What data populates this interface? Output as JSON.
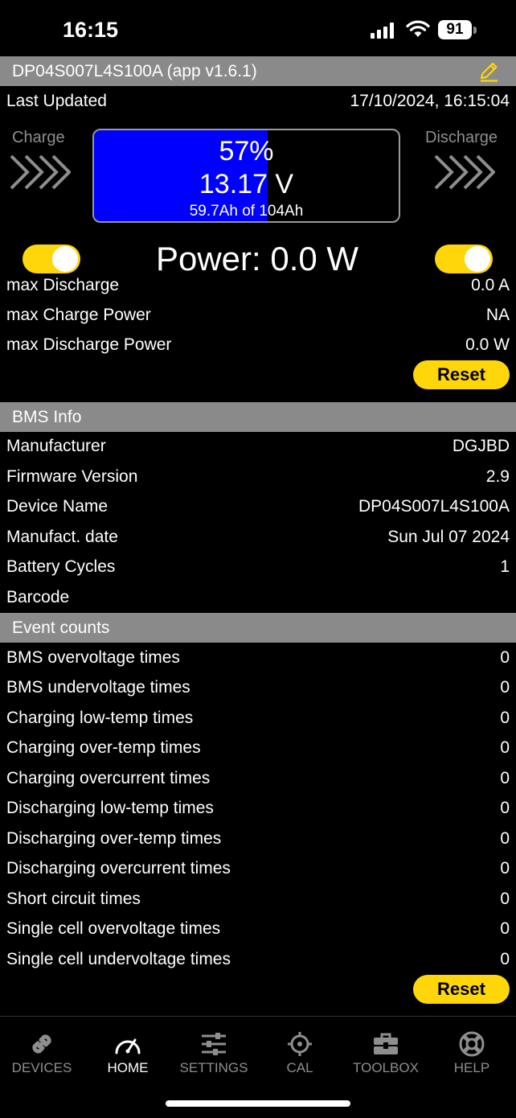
{
  "status": {
    "time": "16:15",
    "battery": "91"
  },
  "header": {
    "title": "DP04S007L4S100A (app v1.6.1)"
  },
  "last_updated": {
    "label": "Last Updated",
    "value": "17/10/2024, 16:15:04"
  },
  "gauge": {
    "charge_label": "Charge",
    "discharge_label": "Discharge",
    "percent_text": "57%",
    "percent": 57,
    "voltage": "13.17 V",
    "capacity": "59.7Ah of 104Ah",
    "power": "Power: 0.0 W",
    "charge_enabled": true,
    "discharge_enabled": true
  },
  "max_stats": [
    {
      "label": "max Discharge",
      "value": "0.0 A"
    },
    {
      "label": "max Charge Power",
      "value": "NA"
    },
    {
      "label": "max Discharge Power",
      "value": "0.0 W"
    }
  ],
  "reset_label": "Reset",
  "bms": {
    "title": "BMS Info",
    "rows": [
      {
        "label": "Manufacturer",
        "value": "DGJBD"
      },
      {
        "label": "Firmware Version",
        "value": "2.9"
      },
      {
        "label": "Device Name",
        "value": "DP04S007L4S100A"
      },
      {
        "label": "Manufact. date",
        "value": "Sun Jul 07 2024"
      },
      {
        "label": "Battery Cycles",
        "value": "1"
      },
      {
        "label": "Barcode",
        "value": ""
      }
    ]
  },
  "events": {
    "title": "Event counts",
    "rows": [
      {
        "label": "BMS overvoltage times",
        "value": "0"
      },
      {
        "label": "BMS undervoltage times",
        "value": "0"
      },
      {
        "label": "Charging low-temp times",
        "value": "0"
      },
      {
        "label": "Charging over-temp times",
        "value": "0"
      },
      {
        "label": "Charging overcurrent times",
        "value": "0"
      },
      {
        "label": "Discharging low-temp times",
        "value": "0"
      },
      {
        "label": "Discharging over-temp times",
        "value": "0"
      },
      {
        "label": "Discharging overcurrent times",
        "value": "0"
      },
      {
        "label": "Short circuit times",
        "value": "0"
      },
      {
        "label": "Single cell overvoltage times",
        "value": "0"
      },
      {
        "label": "Single cell undervoltage times",
        "value": "0"
      }
    ]
  },
  "tabs": [
    {
      "label": "DEVICES",
      "icon": "link-icon",
      "active": false
    },
    {
      "label": "HOME",
      "icon": "speedometer-icon",
      "active": true
    },
    {
      "label": "SETTINGS",
      "icon": "sliders-icon",
      "active": false
    },
    {
      "label": "CAL",
      "icon": "crosshair-icon",
      "active": false
    },
    {
      "label": "TOOLBOX",
      "icon": "toolbox-icon",
      "active": false
    },
    {
      "label": "HELP",
      "icon": "lifebuoy-icon",
      "active": false
    }
  ],
  "colors": {
    "accent": "#ffd60a",
    "fill": "#0000ff",
    "section": "#8a8a8a",
    "muted": "#8e8e8e"
  }
}
